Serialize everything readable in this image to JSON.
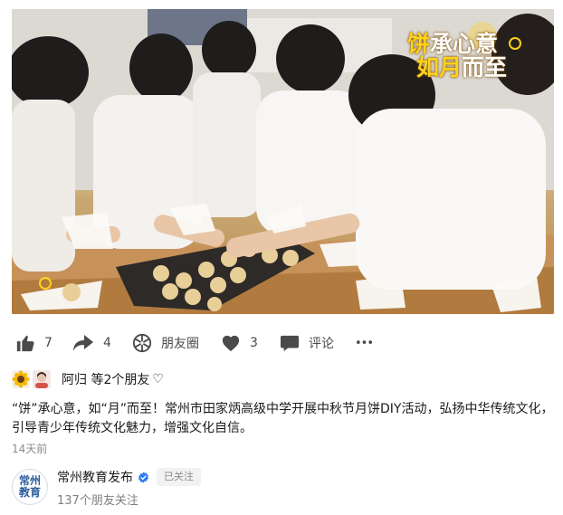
{
  "video": {
    "overlay_title_hl1": "饼",
    "overlay_title_rest1": "承心意",
    "overlay_title_hl2": "如月",
    "overlay_title_rest2": "而至"
  },
  "actions": {
    "like": {
      "icon": "thumbs-up-icon",
      "count": "7"
    },
    "share": {
      "icon": "share-arrow-icon",
      "count": "4"
    },
    "moments": {
      "icon": "moments-aperture-icon",
      "label": "朋友圈"
    },
    "favorite": {
      "icon": "heart-icon",
      "count": "3"
    },
    "comment": {
      "icon": "comment-bubble-icon",
      "label": "评论"
    },
    "more": {
      "icon": "more-dots-icon",
      "label": "•••"
    }
  },
  "likes": {
    "names": "阿归 等2个朋友",
    "heart_icon": "♡"
  },
  "post": {
    "caption": "“饼”承心意，如“月”而至！常州市田家炳高级中学开展中秋节月饼DIY活动，弘扬中华传统文化，引导青少年传统文化魅力，增强文化自信。",
    "time": "14天前"
  },
  "account": {
    "logo_text": "常州教育",
    "name": "常州教育发布",
    "followed_label": "已关注",
    "friends_follow": "137个朋友关注",
    "verified_color": "#2f7cf6"
  }
}
